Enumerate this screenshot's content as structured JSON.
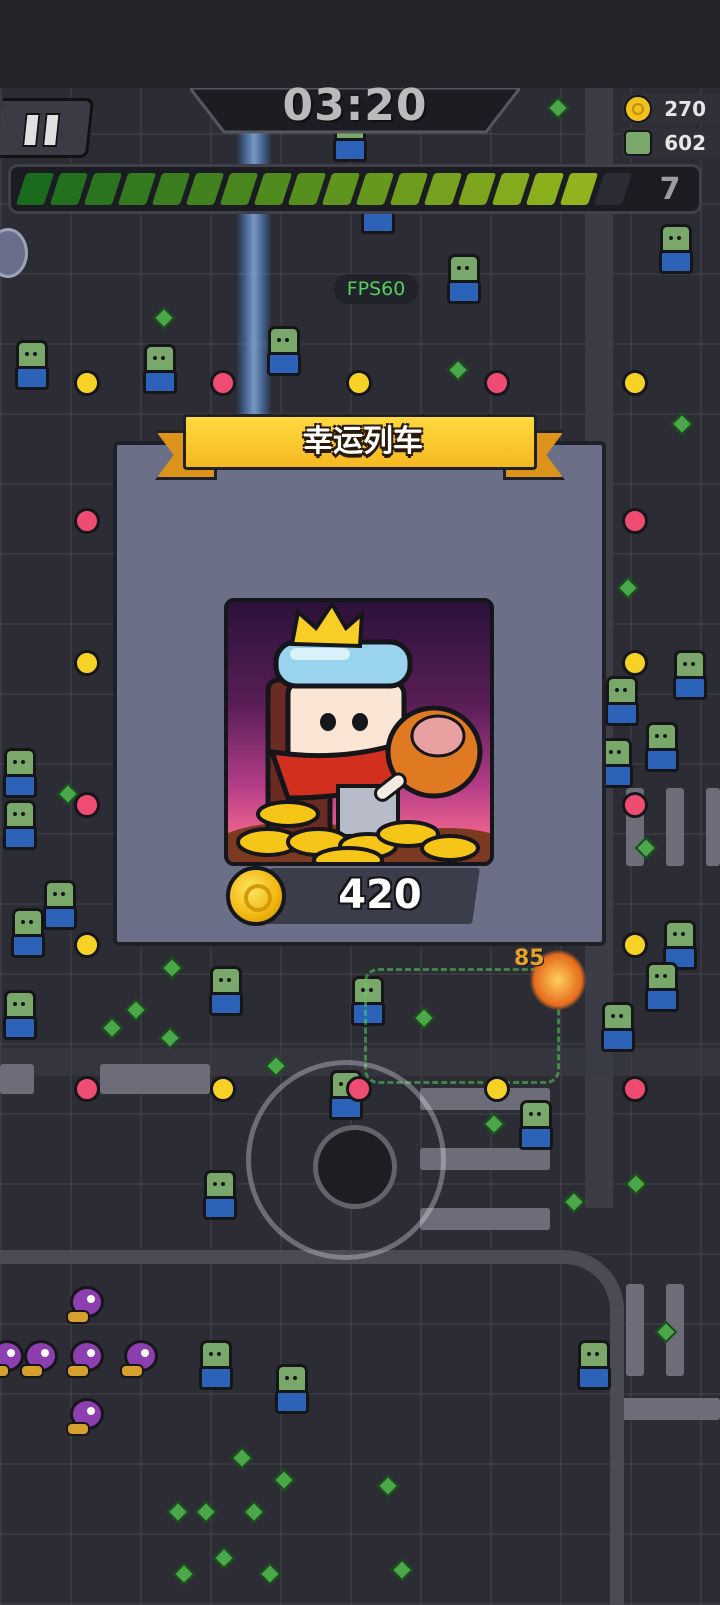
{
  "hud": {
    "timer": "03:20",
    "coins": "270",
    "kills": "602",
    "level": "7",
    "fps_label": "FPS60",
    "damage_popup": "85"
  },
  "xp_bar": {
    "progress_fraction": 0.96,
    "color_start": "#1b6b1f",
    "color_end": "#9bb81e"
  },
  "lucky_train_dialog": {
    "title": "幸运列车",
    "reward_amount": "420",
    "reward_icon": "gold-coin-icon",
    "card_art": "king-knight-with-meat-and-gold"
  },
  "colors": {
    "panel": "#6c6f88",
    "banner": "#f6b820",
    "coin": "#f2b60d",
    "yellow_marker": "#f5d225",
    "pink_marker": "#ef4c72"
  },
  "joystick": {
    "icon": "joystick-icon"
  }
}
